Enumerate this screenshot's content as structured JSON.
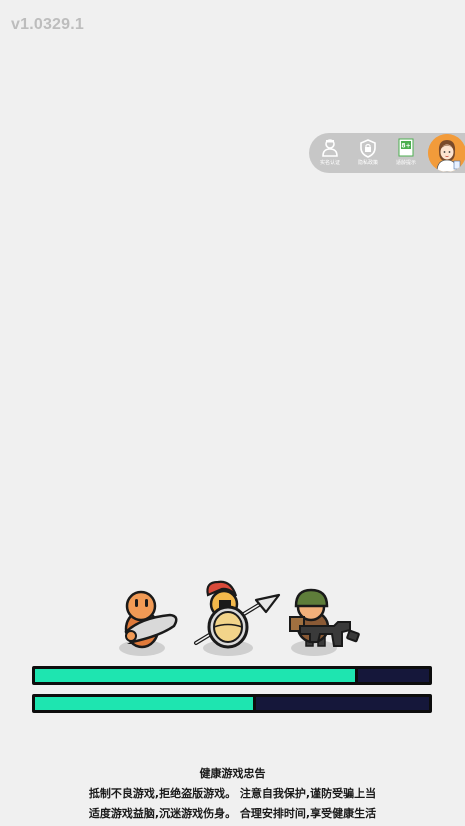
{
  "version": "v1.0329.1",
  "top_menu": {
    "buttons": [
      {
        "label": "实名认证",
        "icon": "id-card-icon"
      },
      {
        "label": "隐私政策",
        "icon": "shield-icon"
      },
      {
        "label": "适龄提示",
        "icon": "age-rating-icon",
        "badge": "8+"
      }
    ],
    "avatar": "cartoon-girl-avatar"
  },
  "characters": [
    {
      "name": "club-caveman",
      "color": "#e07a3a"
    },
    {
      "name": "spartan-spearman",
      "color": "#d94a3a"
    },
    {
      "name": "rifle-soldier",
      "color": "#5e7d3a"
    }
  ],
  "bars": [
    {
      "name": "loading-bar-1",
      "progress": 0.82,
      "fill_color": "#1ee5b0",
      "track_color": "#15173a"
    },
    {
      "name": "loading-bar-2",
      "progress": 0.56,
      "fill_color": "#1ee5b0",
      "track_color": "#15173a"
    }
  ],
  "notice": {
    "title": "健康游戏忠告",
    "line1": "抵制不良游戏,拒绝盗版游戏。 注意自我保护,谨防受骗上当",
    "line2": "适度游戏益脑,沉迷游戏伤身。 合理安排时间,享受健康生活"
  }
}
